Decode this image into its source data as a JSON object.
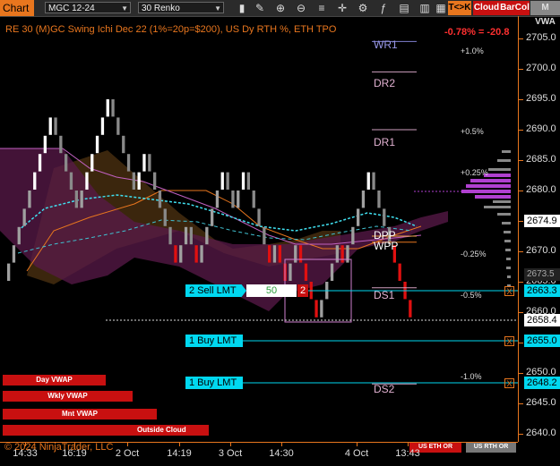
{
  "toolbar": {
    "chart_label": "Chart",
    "instrument": "MGC 12-24",
    "period": "30 Renko",
    "tk_button": "T<>K",
    "cloud_button": "Cloud",
    "barcol_button": "BarCol",
    "mvwa_button": "M VWA"
  },
  "chart_title": "RE 30 (M)GC Swing Ichi Dec 22 (1%=20p=$200), US Dy RTH %, ETH TPO",
  "change_text": "-0.78% = -20.8",
  "levels": {
    "wr1": "WR1",
    "dr2": "DR2",
    "dr1": "DR1",
    "dpp": "DPP",
    "wpp": "WPP",
    "ds1": "DS1",
    "ds2": "DS2"
  },
  "percent_labels": [
    "+1.0%",
    "+0.5%",
    "+0.25%",
    "-0.25%",
    "-0.5%",
    "-1.0%"
  ],
  "orders": {
    "sell_label": "2 Sell LMT",
    "sell_qty": "50",
    "sell_count": "2",
    "buy1_label": "1 Buy LMT",
    "buy2_label": "1 Buy LMT"
  },
  "order_marker": "X",
  "vwap_buttons": {
    "day": "Day VWAP",
    "weekly": "Wkly VWAP",
    "monthly": "Mnt VWAP",
    "outside_cloud": "Outside Cloud"
  },
  "brand": "© 2024 NinjaTrader, LLC",
  "session_buttons": {
    "eth": "US ETH OR",
    "rth": "US RTH OR"
  },
  "price_axis": {
    "ticks": [
      "2705.0",
      "2700.0",
      "2695.0",
      "2690.0",
      "2685.0",
      "2680.0",
      "2675.0",
      "2670.0",
      "2665.0",
      "2660.0",
      "2655.0",
      "2650.0",
      "2645.0",
      "2640.0"
    ],
    "boxes": {
      "last": "2674.9",
      "sell": "2663.3",
      "current": "2658.4",
      "buy1": "2655.0",
      "buy2": "2648.2"
    },
    "partial": "2673.5"
  },
  "time_axis": [
    "14:33",
    "16:19",
    "2 Oct",
    "14:19",
    "3 Oct",
    "14:30",
    "4 Oct",
    "13:43"
  ],
  "colors": {
    "accent": "#e8761e",
    "order_cyan": "#00d8f0",
    "sell_red": "#c81010",
    "cloud_purple": "#5a1a4a",
    "cloud_brown": "#4a3010",
    "profile_purple": "#b040d0"
  },
  "chart_data": {
    "type": "renko",
    "box_size": 3.0,
    "ylim": [
      2638,
      2708
    ],
    "bricks": [
      {
        "x": 0,
        "o": 2665,
        "c": 2668
      },
      {
        "x": 1,
        "o": 2668,
        "c": 2671
      },
      {
        "x": 2,
        "o": 2671,
        "c": 2674
      },
      {
        "x": 3,
        "o": 2674,
        "c": 2677
      },
      {
        "x": 4,
        "o": 2677,
        "c": 2680
      },
      {
        "x": 5,
        "o": 2680,
        "c": 2683
      },
      {
        "x": 6,
        "o": 2683,
        "c": 2686
      },
      {
        "x": 7,
        "o": 2686,
        "c": 2689
      },
      {
        "x": 8,
        "o": 2689,
        "c": 2692
      },
      {
        "x": 9,
        "o": 2692,
        "c": 2689
      },
      {
        "x": 10,
        "o": 2689,
        "c": 2686
      },
      {
        "x": 11,
        "o": 2686,
        "c": 2683
      },
      {
        "x": 12,
        "o": 2683,
        "c": 2680
      },
      {
        "x": 13,
        "o": 2680,
        "c": 2677
      },
      {
        "x": 14,
        "o": 2677,
        "c": 2680
      },
      {
        "x": 15,
        "o": 2680,
        "c": 2683
      },
      {
        "x": 16,
        "o": 2683,
        "c": 2686
      },
      {
        "x": 17,
        "o": 2686,
        "c": 2689
      },
      {
        "x": 18,
        "o": 2689,
        "c": 2692
      },
      {
        "x": 19,
        "o": 2692,
        "c": 2695
      },
      {
        "x": 20,
        "o": 2695,
        "c": 2692
      },
      {
        "x": 21,
        "o": 2692,
        "c": 2689
      },
      {
        "x": 22,
        "o": 2689,
        "c": 2686
      },
      {
        "x": 23,
        "o": 2686,
        "c": 2683
      },
      {
        "x": 24,
        "o": 2683,
        "c": 2680
      },
      {
        "x": 25,
        "o": 2680,
        "c": 2683
      },
      {
        "x": 26,
        "o": 2683,
        "c": 2686
      },
      {
        "x": 27,
        "o": 2686,
        "c": 2683
      },
      {
        "x": 28,
        "o": 2683,
        "c": 2680
      },
      {
        "x": 29,
        "o": 2680,
        "c": 2677
      },
      {
        "x": 30,
        "o": 2677,
        "c": 2674
      },
      {
        "x": 31,
        "o": 2674,
        "c": 2671
      },
      {
        "x": 32,
        "o": 2671,
        "c": 2668
      },
      {
        "x": 33,
        "o": 2668,
        "c": 2671
      },
      {
        "x": 34,
        "o": 2671,
        "c": 2674
      },
      {
        "x": 35,
        "o": 2674,
        "c": 2671
      },
      {
        "x": 36,
        "o": 2671,
        "c": 2668
      },
      {
        "x": 37,
        "o": 2668,
        "c": 2671
      },
      {
        "x": 38,
        "o": 2671,
        "c": 2674
      },
      {
        "x": 39,
        "o": 2674,
        "c": 2677
      },
      {
        "x": 40,
        "o": 2677,
        "c": 2680
      },
      {
        "x": 41,
        "o": 2680,
        "c": 2683
      },
      {
        "x": 42,
        "o": 2683,
        "c": 2680
      },
      {
        "x": 43,
        "o": 2680,
        "c": 2677
      },
      {
        "x": 44,
        "o": 2677,
        "c": 2680
      },
      {
        "x": 45,
        "o": 2680,
        "c": 2683
      },
      {
        "x": 46,
        "o": 2683,
        "c": 2680
      },
      {
        "x": 47,
        "o": 2680,
        "c": 2677
      },
      {
        "x": 48,
        "o": 2677,
        "c": 2674
      },
      {
        "x": 49,
        "o": 2674,
        "c": 2671
      },
      {
        "x": 50,
        "o": 2671,
        "c": 2668
      },
      {
        "x": 51,
        "o": 2668,
        "c": 2671
      },
      {
        "x": 52,
        "o": 2671,
        "c": 2668
      },
      {
        "x": 53,
        "o": 2668,
        "c": 2665
      },
      {
        "x": 54,
        "o": 2665,
        "c": 2668
      },
      {
        "x": 55,
        "o": 2668,
        "c": 2671
      },
      {
        "x": 56,
        "o": 2671,
        "c": 2668
      },
      {
        "x": 57,
        "o": 2668,
        "c": 2665
      },
      {
        "x": 58,
        "o": 2665,
        "c": 2662
      },
      {
        "x": 59,
        "o": 2662,
        "c": 2659
      },
      {
        "x": 60,
        "o": 2659,
        "c": 2662
      },
      {
        "x": 61,
        "o": 2662,
        "c": 2665
      },
      {
        "x": 62,
        "o": 2665,
        "c": 2668
      },
      {
        "x": 63,
        "o": 2668,
        "c": 2671
      },
      {
        "x": 64,
        "o": 2671,
        "c": 2668
      },
      {
        "x": 65,
        "o": 2668,
        "c": 2671
      },
      {
        "x": 66,
        "o": 2671,
        "c": 2674
      },
      {
        "x": 67,
        "o": 2674,
        "c": 2677
      },
      {
        "x": 68,
        "o": 2677,
        "c": 2680
      },
      {
        "x": 69,
        "o": 2680,
        "c": 2683
      },
      {
        "x": 70,
        "o": 2683,
        "c": 2680
      },
      {
        "x": 71,
        "o": 2680,
        "c": 2677
      },
      {
        "x": 72,
        "o": 2677,
        "c": 2674
      },
      {
        "x": 73,
        "o": 2674,
        "c": 2671
      },
      {
        "x": 74,
        "o": 2671,
        "c": 2668
      },
      {
        "x": 75,
        "o": 2668,
        "c": 2665
      },
      {
        "x": 76,
        "o": 2665,
        "c": 2662
      },
      {
        "x": 77,
        "o": 2662,
        "c": 2659
      }
    ],
    "level_prices": {
      "wr1": 2704.5,
      "dr2": 2699.5,
      "dr1": 2690.0,
      "dpp": 2672.5,
      "wpp": 2671.5,
      "ds1": 2664.0,
      "ds2": 2648.2
    },
    "order_prices": {
      "sell": 2663.3,
      "buy1": 2655.0,
      "buy2": 2648.2,
      "current": 2658.4
    }
  }
}
